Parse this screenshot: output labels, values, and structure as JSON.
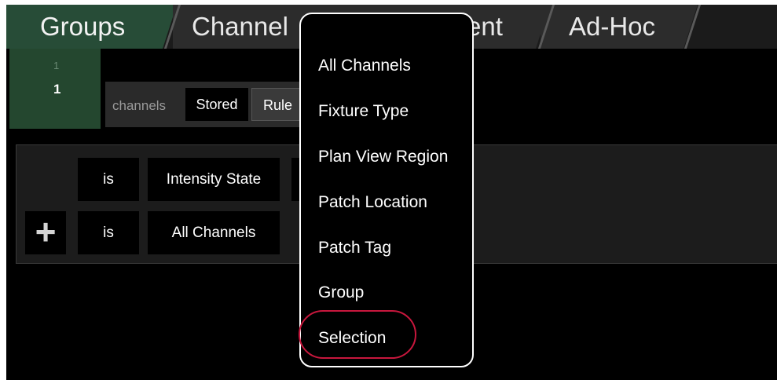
{
  "tabs": [
    {
      "label": "Groups",
      "active": true
    },
    {
      "label": "Channel"
    },
    {
      "label": "ent"
    },
    {
      "label": "Ad-Hoc"
    }
  ],
  "group_item": {
    "small_number": "1",
    "number": "1"
  },
  "channels_row": {
    "label": "channels",
    "stored_label": "Stored",
    "rules_label": "Rule"
  },
  "rules": [
    {
      "operator": "is",
      "value": "Intensity State"
    },
    {
      "operator": "is",
      "value": "All Channels"
    }
  ],
  "add_icon": "plus-icon",
  "menu": {
    "items": [
      "All Channels",
      "Fixture Type",
      "Plan View Region",
      "Patch Location",
      "Patch Tag",
      "Group",
      "Selection"
    ],
    "highlighted": "Selection"
  },
  "colors": {
    "active_tab": "#274c37",
    "highlight_ring": "#c8173d"
  }
}
